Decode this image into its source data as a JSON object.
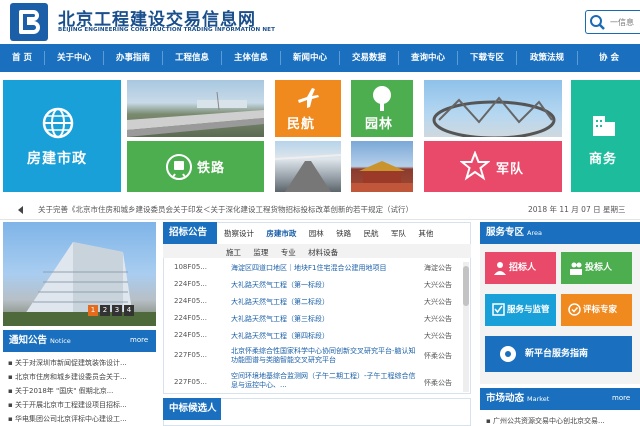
{
  "header": {
    "title": "北京工程建设交易信息网",
    "subtitle": "BEIJING ENGINEERING CONSTRUCTION TRADING INFORMATION NET",
    "search_placeholder": "一信息"
  },
  "nav": [
    "首 页",
    "关于中心",
    "办事指南",
    "工程信息",
    "主体信息",
    "新闻中心",
    "交易数据",
    "查询中心",
    "下载专区",
    "政策法规",
    "协 会"
  ],
  "tiles": {
    "fangjian": "房建市政",
    "minhang": "民航",
    "yuanlin": "园林",
    "tielu": "铁路",
    "junduei": "军队",
    "shangwu": "商务"
  },
  "ticker": {
    "text": "关于完善《北京市住房和城乡建设委员会关于印发＜关于深化建设工程货物招标投标改革创新的若干规定（试行）",
    "date": "2018 年 11 月 07 日 星期三"
  },
  "slider": {
    "pages": [
      "1",
      "2",
      "3",
      "4"
    ]
  },
  "notice": {
    "title": "通知公告",
    "title_en": "Notice",
    "more": "more",
    "items": [
      "关于对深圳市新闻促建筑装饰设计...",
      "北京市住房和城乡建设委员会关于...",
      "关于2018年 \"国庆\" 假期北京...",
      "关于开展北京市工程建设项目招标...",
      "华电集团公司北京评标中心建设工..."
    ]
  },
  "bidding": {
    "title": "招标公告",
    "tabs": [
      "勘察设计",
      "房建市政",
      "园林",
      "铁路",
      "民航",
      "军队",
      "其他"
    ],
    "subtabs": [
      "施工",
      "监理",
      "专业",
      "材料设备"
    ],
    "rows": [
      {
        "code": "108F05...",
        "title": "海淀区四道口地区｜地块F1住宅混合公建用地项目",
        "district": "海淀公告"
      },
      {
        "code": "224F05...",
        "title": "大礼路天然气工程（第一标段）",
        "district": "大兴公告"
      },
      {
        "code": "224F05...",
        "title": "大礼路天然气工程（第二标段）",
        "district": "大兴公告"
      },
      {
        "code": "224F05...",
        "title": "大礼路天然气工程（第三标段）",
        "district": "大兴公告"
      },
      {
        "code": "224F05...",
        "title": "大礼路天然气工程（第四标段）",
        "district": "大兴公告"
      },
      {
        "code": "227F05...",
        "title": "北京怀柔综合性国家科学中心协同创新交叉研究平台-脑认知功能图谱与类脑智能交叉研究平台",
        "district": "怀柔公告"
      },
      {
        "code": "227F05...",
        "title": "空间环境地基综合监测网（子午二期工程）-子午工程综合信息与运控中心、...",
        "district": "怀柔公告"
      }
    ]
  },
  "candidate": {
    "title": "中标候选人"
  },
  "service": {
    "title": "服务专区",
    "title_en": "Area",
    "buttons": [
      "招标人",
      "投标人",
      "服务与监管",
      "评标专家",
      "新平台服务指南"
    ]
  },
  "market": {
    "title": "市场动态",
    "title_en": "Market",
    "more": "more",
    "items": [
      "广州公共资源交易中心创北京交易..."
    ]
  }
}
